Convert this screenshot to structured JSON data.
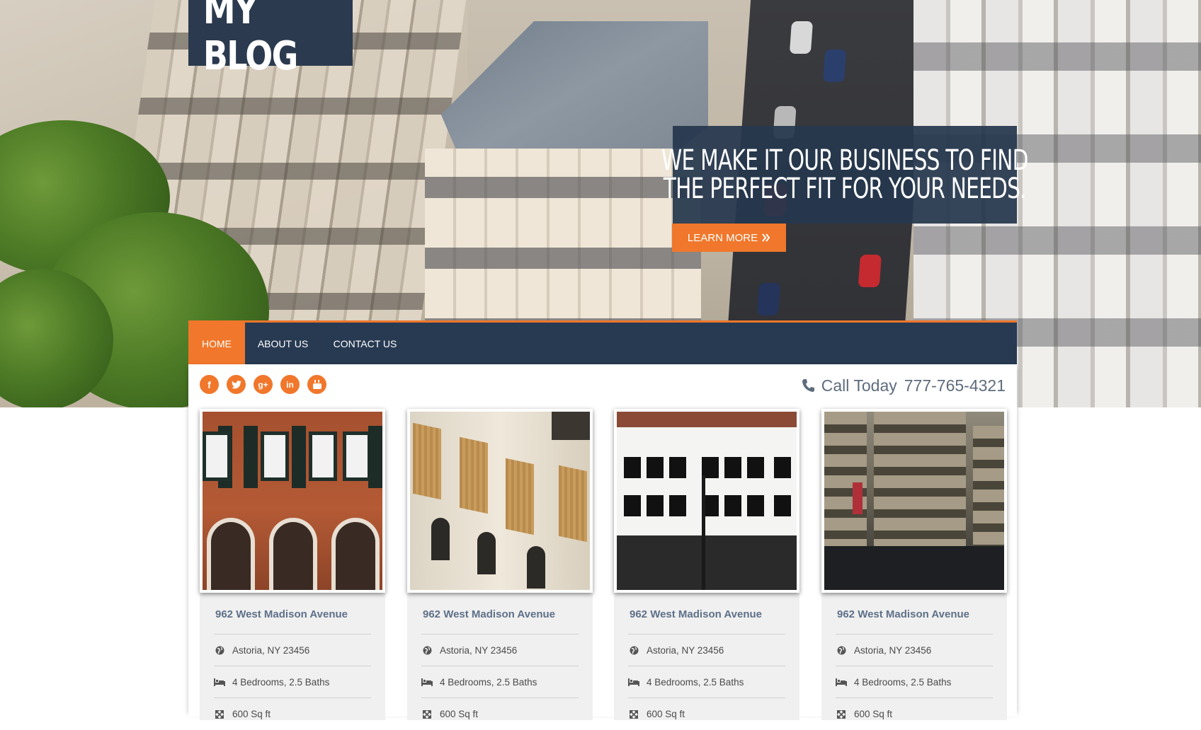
{
  "site": {
    "logo_text": "MY BLOG"
  },
  "hero": {
    "headline_line1": "WE MAKE IT OUR BUSINESS TO FIND",
    "headline_line2": "THE PERFECT FIT FOR YOUR NEEDS.",
    "cta_label": "LEARN MORE",
    "cta_icon": "double-chevron-right-icon"
  },
  "nav": {
    "items": [
      {
        "label": "HOME",
        "active": true
      },
      {
        "label": "ABOUT US",
        "active": false
      },
      {
        "label": "CONTACT US",
        "active": false
      }
    ]
  },
  "social": {
    "icons": [
      "facebook-icon",
      "twitter-icon",
      "google-plus-icon",
      "linkedin-icon",
      "youtube-icon"
    ]
  },
  "contact": {
    "call_label": "Call Today",
    "phone": "777-765-4321",
    "icon": "phone-icon"
  },
  "listings": [
    {
      "title": "962 West Madison Avenue",
      "location": "Astoria, NY 23456",
      "rooms": "4 Bedrooms, 2.5 Baths",
      "area": "600 Sq ft"
    },
    {
      "title": "962 West Madison Avenue",
      "location": "Astoria, NY 23456",
      "rooms": "4 Bedrooms, 2.5 Baths",
      "area": "600 Sq ft"
    },
    {
      "title": "962 West Madison Avenue",
      "location": "Astoria, NY 23456",
      "rooms": "4 Bedrooms, 2.5 Baths",
      "area": "600 Sq ft"
    },
    {
      "title": "962 West Madison Avenue",
      "location": "Astoria, NY 23456",
      "rooms": "4 Bedrooms, 2.5 Baths",
      "area": "600 Sq ft"
    }
  ],
  "colors": {
    "accent": "#f0772b",
    "navy": "#283a52",
    "title_text": "#5e7089"
  }
}
